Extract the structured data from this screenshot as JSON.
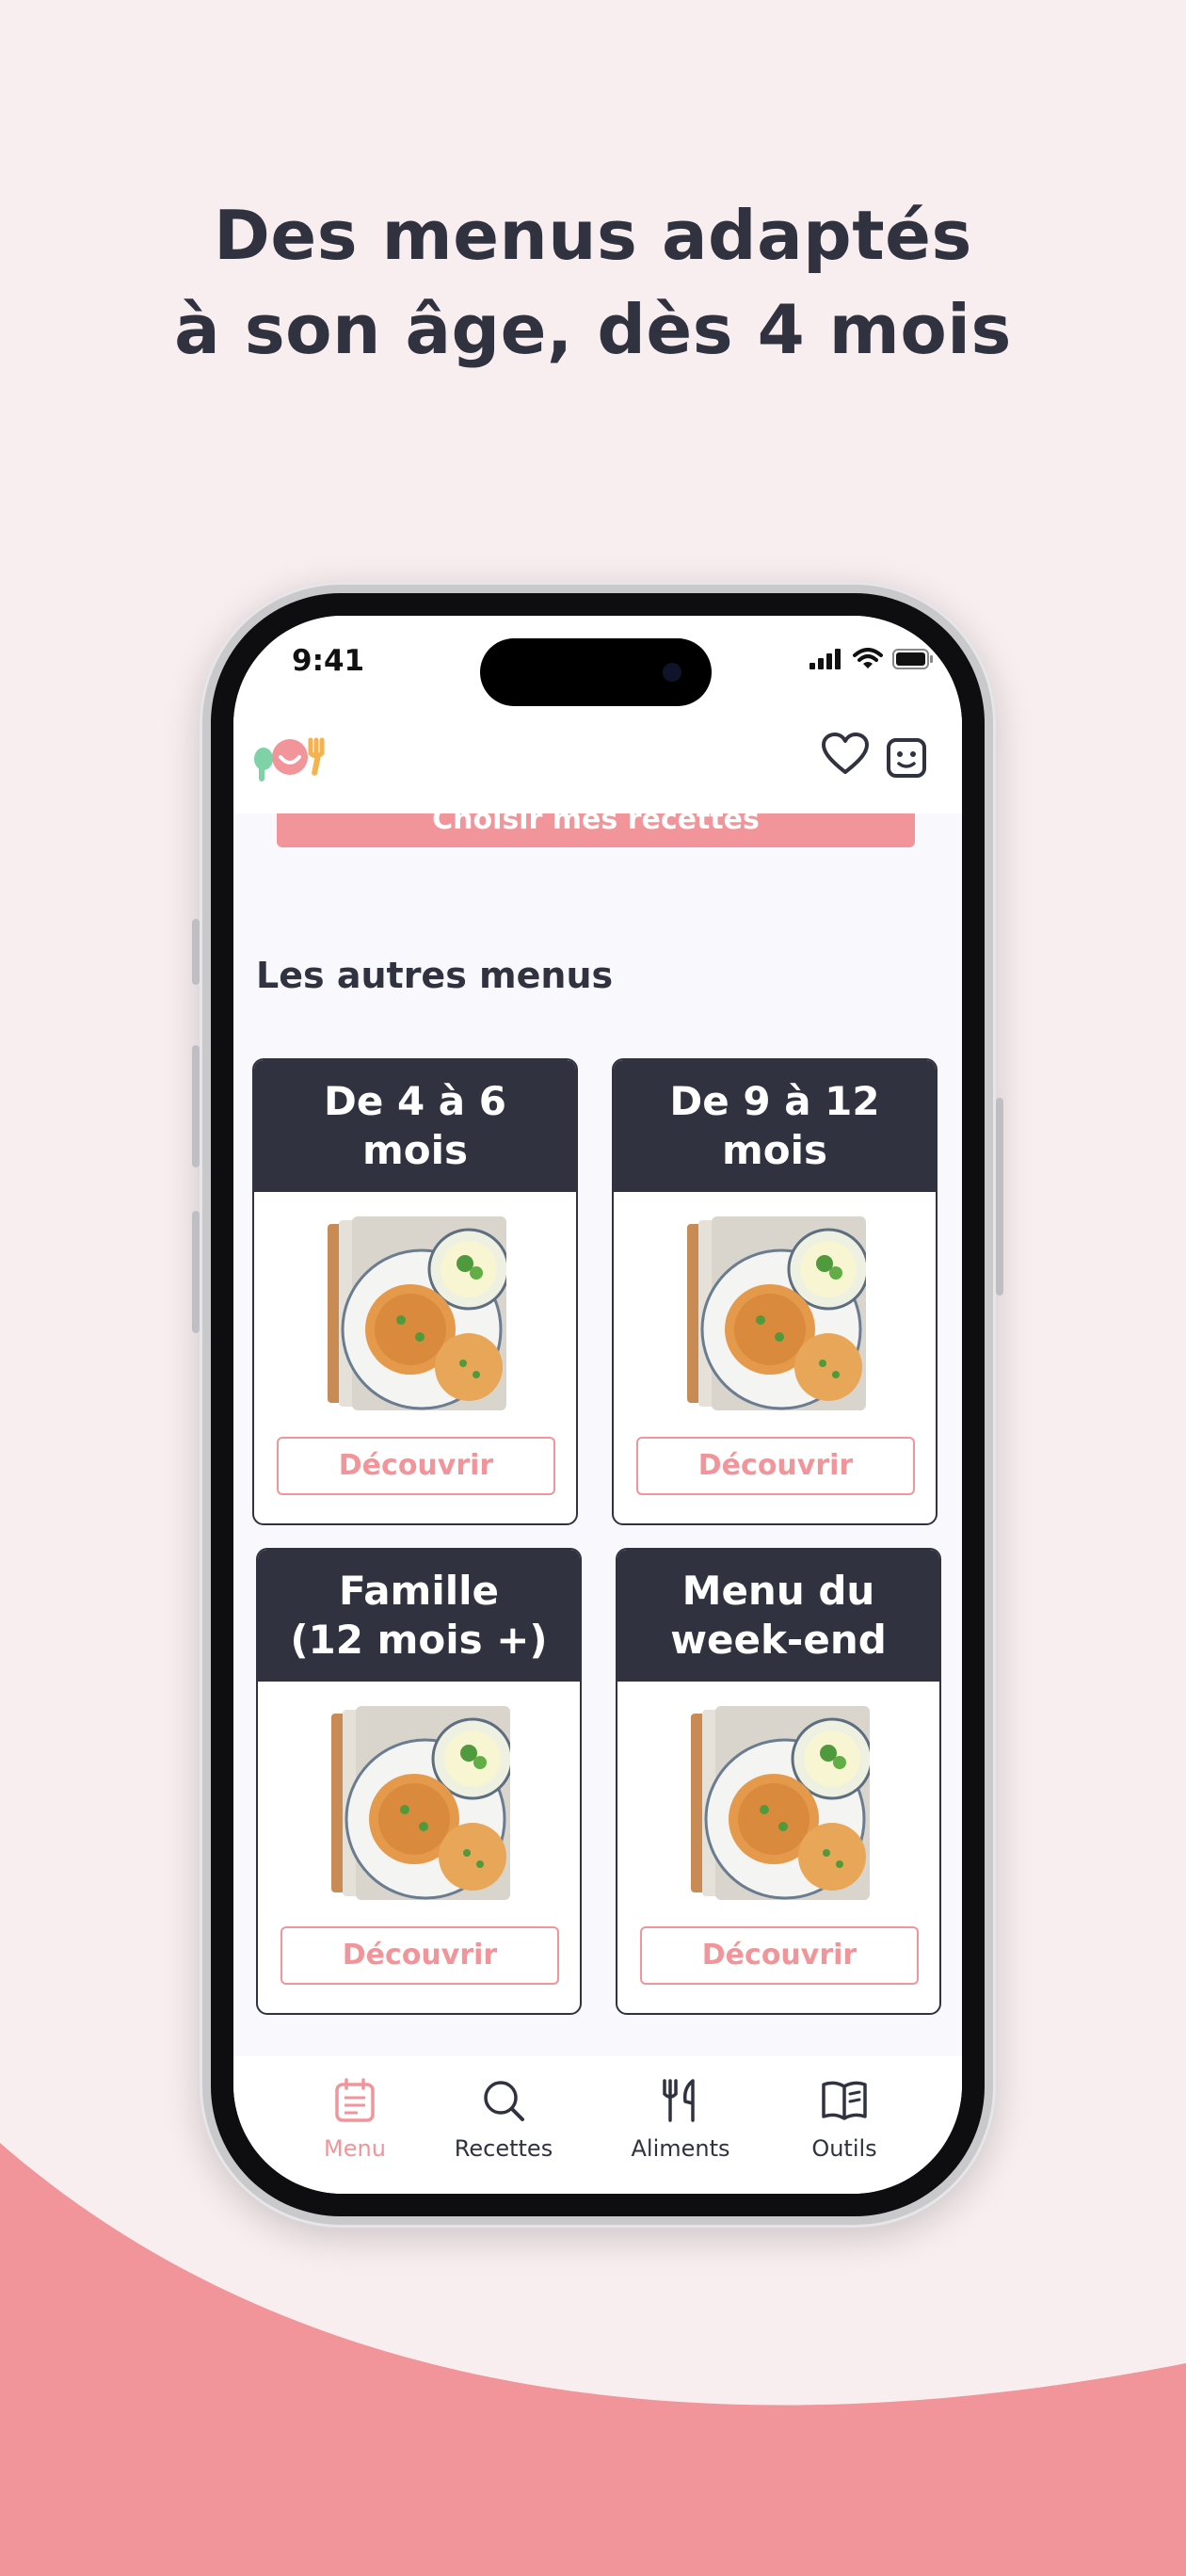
{
  "headline": {
    "line1": "Des menus adaptés",
    "line2": "à son âge, dès 4 mois"
  },
  "colors": {
    "background": "#f8eef0",
    "accent": "#f1959a",
    "dark": "#30323f"
  },
  "status_bar": {
    "time": "9:41",
    "icons": [
      "signal-icon",
      "wifi-icon",
      "battery-icon"
    ]
  },
  "app_header": {
    "logo": "app-logo",
    "icons": [
      "heart-icon",
      "profile-face-icon"
    ]
  },
  "content": {
    "choose_button": "Choisir mes recettes",
    "section_title": "Les autres menus",
    "cards": [
      {
        "title_line1": "De 4 à 6",
        "title_line2": "mois",
        "button": "Découvrir"
      },
      {
        "title_line1": "De 9 à 12",
        "title_line2": "mois",
        "button": "Découvrir"
      },
      {
        "title_line1": "Famille",
        "title_line2": "(12 mois +)",
        "button": "Découvrir"
      },
      {
        "title_line1": "Menu du",
        "title_line2": "week-end",
        "button": "Découvrir"
      }
    ]
  },
  "tabbar": {
    "tabs": [
      {
        "label": "Menu",
        "icon": "menu-notepad-icon",
        "active": true
      },
      {
        "label": "Recettes",
        "icon": "search-icon",
        "active": false
      },
      {
        "label": "Aliments",
        "icon": "fork-knife-icon",
        "active": false
      },
      {
        "label": "Outils",
        "icon": "book-icon",
        "active": false
      }
    ]
  }
}
